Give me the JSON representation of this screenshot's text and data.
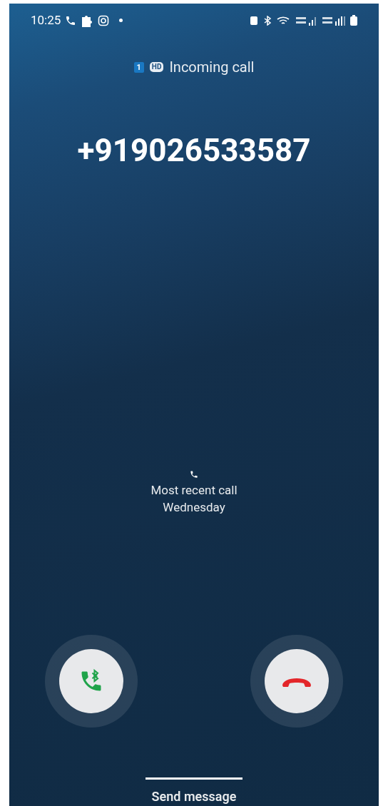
{
  "status_bar": {
    "time": "10:25"
  },
  "call": {
    "sim": "1",
    "hd": "HD",
    "state": "Incoming call",
    "number": "+919026533587"
  },
  "recent": {
    "label": "Most recent call",
    "day": "Wednesday"
  },
  "actions": [
    {
      "kind": "answer"
    },
    {
      "kind": "decline"
    }
  ],
  "bottom": {
    "label": "Send message"
  }
}
